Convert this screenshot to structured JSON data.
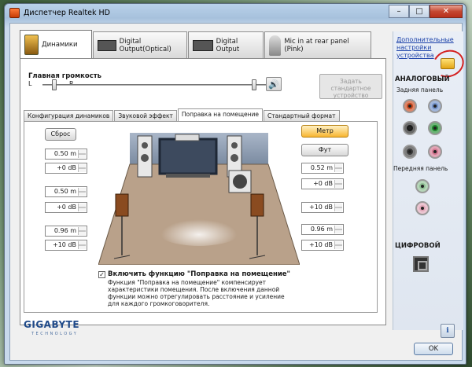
{
  "window": {
    "title": "Диспетчер Realtek HD"
  },
  "device_tabs": [
    {
      "label": "Динамики",
      "active": true
    },
    {
      "label": "Digital Output(Optical)",
      "active": false
    },
    {
      "label": "Digital Output",
      "active": false
    },
    {
      "label": "Mic in at rear panel (Pink)",
      "active": false
    }
  ],
  "main_volume": {
    "label": "Главная громкость",
    "left": "L",
    "right": "R",
    "balance": 0.5,
    "level": 1.0
  },
  "set_default_button": {
    "label": "Задать стандартное устройство"
  },
  "sub_tabs": [
    {
      "label": "Конфигурация динамиков",
      "active": false
    },
    {
      "label": "Звуковой эффект",
      "active": false
    },
    {
      "label": "Поправка на помещение",
      "active": true
    },
    {
      "label": "Стандартный формат",
      "active": false
    }
  ],
  "room_correction": {
    "reset_label": "Сброс",
    "meter_label": "Метр",
    "foot_label": "Фут",
    "left_fields": [
      "0.50  m",
      "+0 dB",
      "0.50  m",
      "+0 dB",
      "0.96  m",
      "+10 dB"
    ],
    "right_fields": [
      "0.52  m",
      "+0 dB",
      "+10 dB",
      "0.96  m",
      "+10 dB"
    ],
    "checkbox": {
      "checked": true,
      "title": "Включить функцию \"Поправка на помещение\"",
      "description": "Функция \"Поправка на помещение\" компенсирует характеристики помещения. После включения данной функции можно отрегулировать расстояние и усиление для каждого громкоговорителя."
    }
  },
  "right_panel": {
    "link": "Дополнительные настройки устройства",
    "analog_title": "АНАЛОГОВЫЙ",
    "rear_panel": "Задняя панель",
    "front_panel": "Передняя панель",
    "digital_title": "ЦИФРОВОЙ",
    "jack_colors": {
      "orange": "#c8471c",
      "blue": "#6f8fc7",
      "black": "#1a1a1a",
      "green": "#1f8a2e",
      "gray": "#3a3a3a",
      "pink": "#d27590",
      "front_green": "#8fbf94",
      "front_pink": "#e0a7b8"
    }
  },
  "brand": {
    "name": "GIGABYTE",
    "tagline": "TECHNOLOGY"
  },
  "ok_button": {
    "label": "OK"
  },
  "info_button": {
    "label": "i"
  }
}
